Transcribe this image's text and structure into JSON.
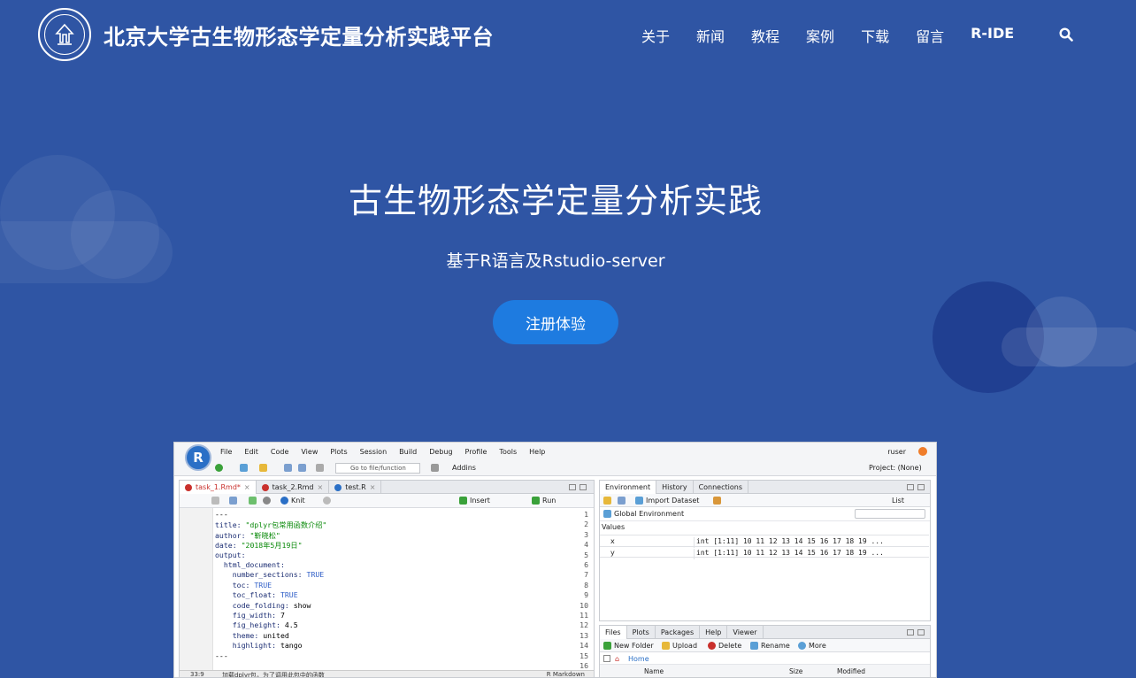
{
  "header": {
    "site_title": "北京大学古生物形态学定量分析实践平台",
    "nav": [
      "关于",
      "新闻",
      "教程",
      "案例",
      "下载",
      "留言",
      "R-IDE"
    ]
  },
  "hero": {
    "title": "古生物形态学定量分析实践",
    "subtitle": "基于R语言及Rstudio-server",
    "cta_label": "注册体验"
  },
  "rstudio": {
    "logo": "R",
    "menu": [
      "File",
      "Edit",
      "Code",
      "View",
      "Plots",
      "Session",
      "Build",
      "Debug",
      "Profile",
      "Tools",
      "Help"
    ],
    "user": "ruser",
    "toolbar": {
      "goto_placeholder": "Go to file/function",
      "addins": "Addins",
      "project": "Project: (None)"
    },
    "editor": {
      "tabs": [
        "task_1.Rmd*",
        "task_2.Rmd",
        "test.R"
      ],
      "knit": "Knit",
      "insert": "Insert",
      "run": "Run",
      "lines": [
        "---",
        "title: \"dplyr包常用函数介绍\"",
        "author: \"靳晓松\"",
        "date: \"2018年5月19日\"",
        "output:",
        "  html_document:",
        "    number_sections: TRUE",
        "    toc: TRUE",
        "    toc_float: TRUE",
        "    code_folding: show",
        "    fig_width: 7",
        "    fig_height: 4.5",
        "    theme: united",
        "    highlight: tango",
        "---",
        ""
      ],
      "status_pos": "33:9",
      "status_text": "加载dplyr包，为了调用此包中的函数",
      "status_mode": "R Markdown"
    },
    "env": {
      "tabs": [
        "Environment",
        "History",
        "Connections"
      ],
      "import": "Import Dataset",
      "list": "List",
      "scope": "Global Environment",
      "values_header": "Values",
      "vars": [
        {
          "name": "x",
          "value": "int [1:11] 10 11 12 13 14 15 16 17 18 19 ..."
        },
        {
          "name": "y",
          "value": "int [1:11] 10 11 12 13 14 15 16 17 18 19 ..."
        }
      ]
    },
    "files": {
      "tabs": [
        "Files",
        "Plots",
        "Packages",
        "Help",
        "Viewer"
      ],
      "new_folder": "New Folder",
      "upload": "Upload",
      "delete": "Delete",
      "rename": "Rename",
      "more": "More",
      "home": "Home",
      "col_name": "Name",
      "col_size": "Size",
      "col_modified": "Modified"
    }
  }
}
